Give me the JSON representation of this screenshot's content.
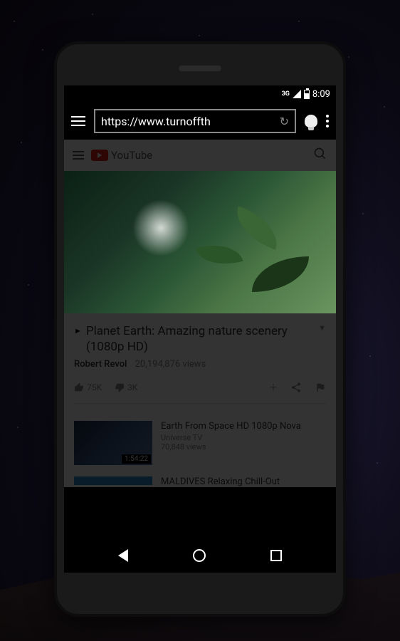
{
  "status": {
    "network": "3G",
    "time": "8:09"
  },
  "browser": {
    "url": "https://www.turnoffth"
  },
  "youtube": {
    "brand": "YouTube",
    "video": {
      "title": "Planet Earth: Amazing nature scenery (1080p HD)",
      "channel": "Robert Revol",
      "views": "20,194,876 views",
      "likes": "75K",
      "dislikes": "3K"
    },
    "related": [
      {
        "title": "Earth From Space HD 1080p Nova",
        "channel": "Universe TV",
        "views": "70,848 views",
        "duration": "1:54:22"
      },
      {
        "title": "MALDIVES Relaxing Chill-Out"
      }
    ]
  }
}
